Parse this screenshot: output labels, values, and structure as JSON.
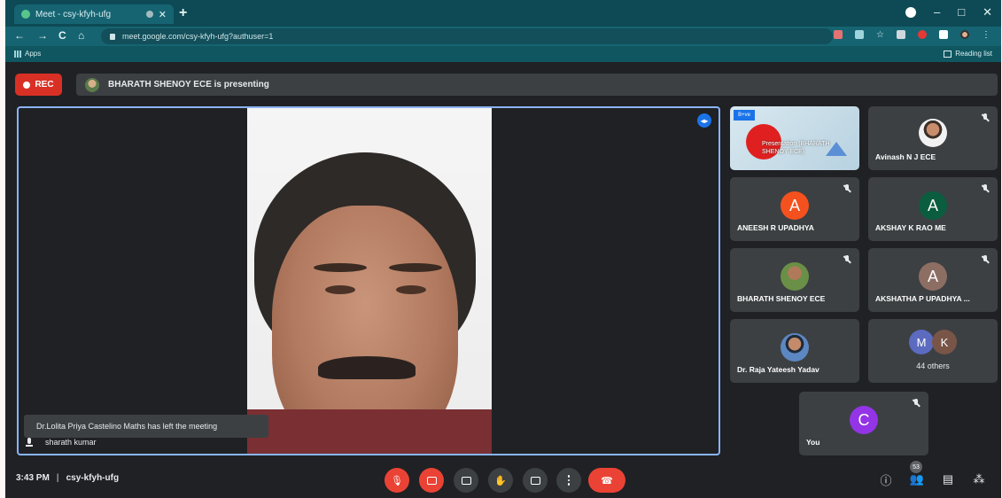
{
  "browser": {
    "tab_title": "Meet - csy-kfyh-ufg",
    "new_tab": "+",
    "url": "meet.google.com/csy-kfyh-ufg?authuser=1",
    "bookmark_apps": "Apps",
    "reading_list": "Reading list",
    "nav": {
      "back": "←",
      "forward": "→",
      "reload": "C",
      "home": "⌂"
    },
    "window": {
      "minimize": "–",
      "maximize": "□",
      "close": "✕"
    }
  },
  "meet": {
    "rec_label": "REC",
    "presenting_banner": "BHARATH SHENOY ECE is presenting",
    "toast": "Dr.Lolita Priya Castelino Maths has left the meeting",
    "main_speaker": "sharath kumar",
    "presentation_tile": {
      "badge": "B+ve",
      "text": "Presentation (BHARATH SHENOY ECE)"
    },
    "participants": [
      {
        "name": "Avinash N J ECE",
        "initial": "",
        "color": ""
      },
      {
        "name": "ANEESH R UPADHYA",
        "initial": "A",
        "color": "#f4511e"
      },
      {
        "name": "AKSHAY K RAO ME",
        "initial": "A",
        "color": "#0b5d3f"
      },
      {
        "name": "BHARATH SHENOY ECE",
        "initial": "",
        "color": ""
      },
      {
        "name": "AKSHATHA P UPADHYA ...",
        "initial": "A",
        "color": "#8d6e63"
      },
      {
        "name": "Dr. Raja Yateesh Yadav",
        "initial": "",
        "color": ""
      },
      {
        "name": "You",
        "initial": "C",
        "color": "#9334e6"
      }
    ],
    "others": {
      "avatars": [
        "M",
        "K"
      ],
      "colors": [
        "#5c6bc0",
        "#795548"
      ],
      "label": "44 others"
    },
    "time": "3:43 PM",
    "separator": "|",
    "meeting_code": "csy-kfyh-ufg",
    "participant_count": "53"
  }
}
